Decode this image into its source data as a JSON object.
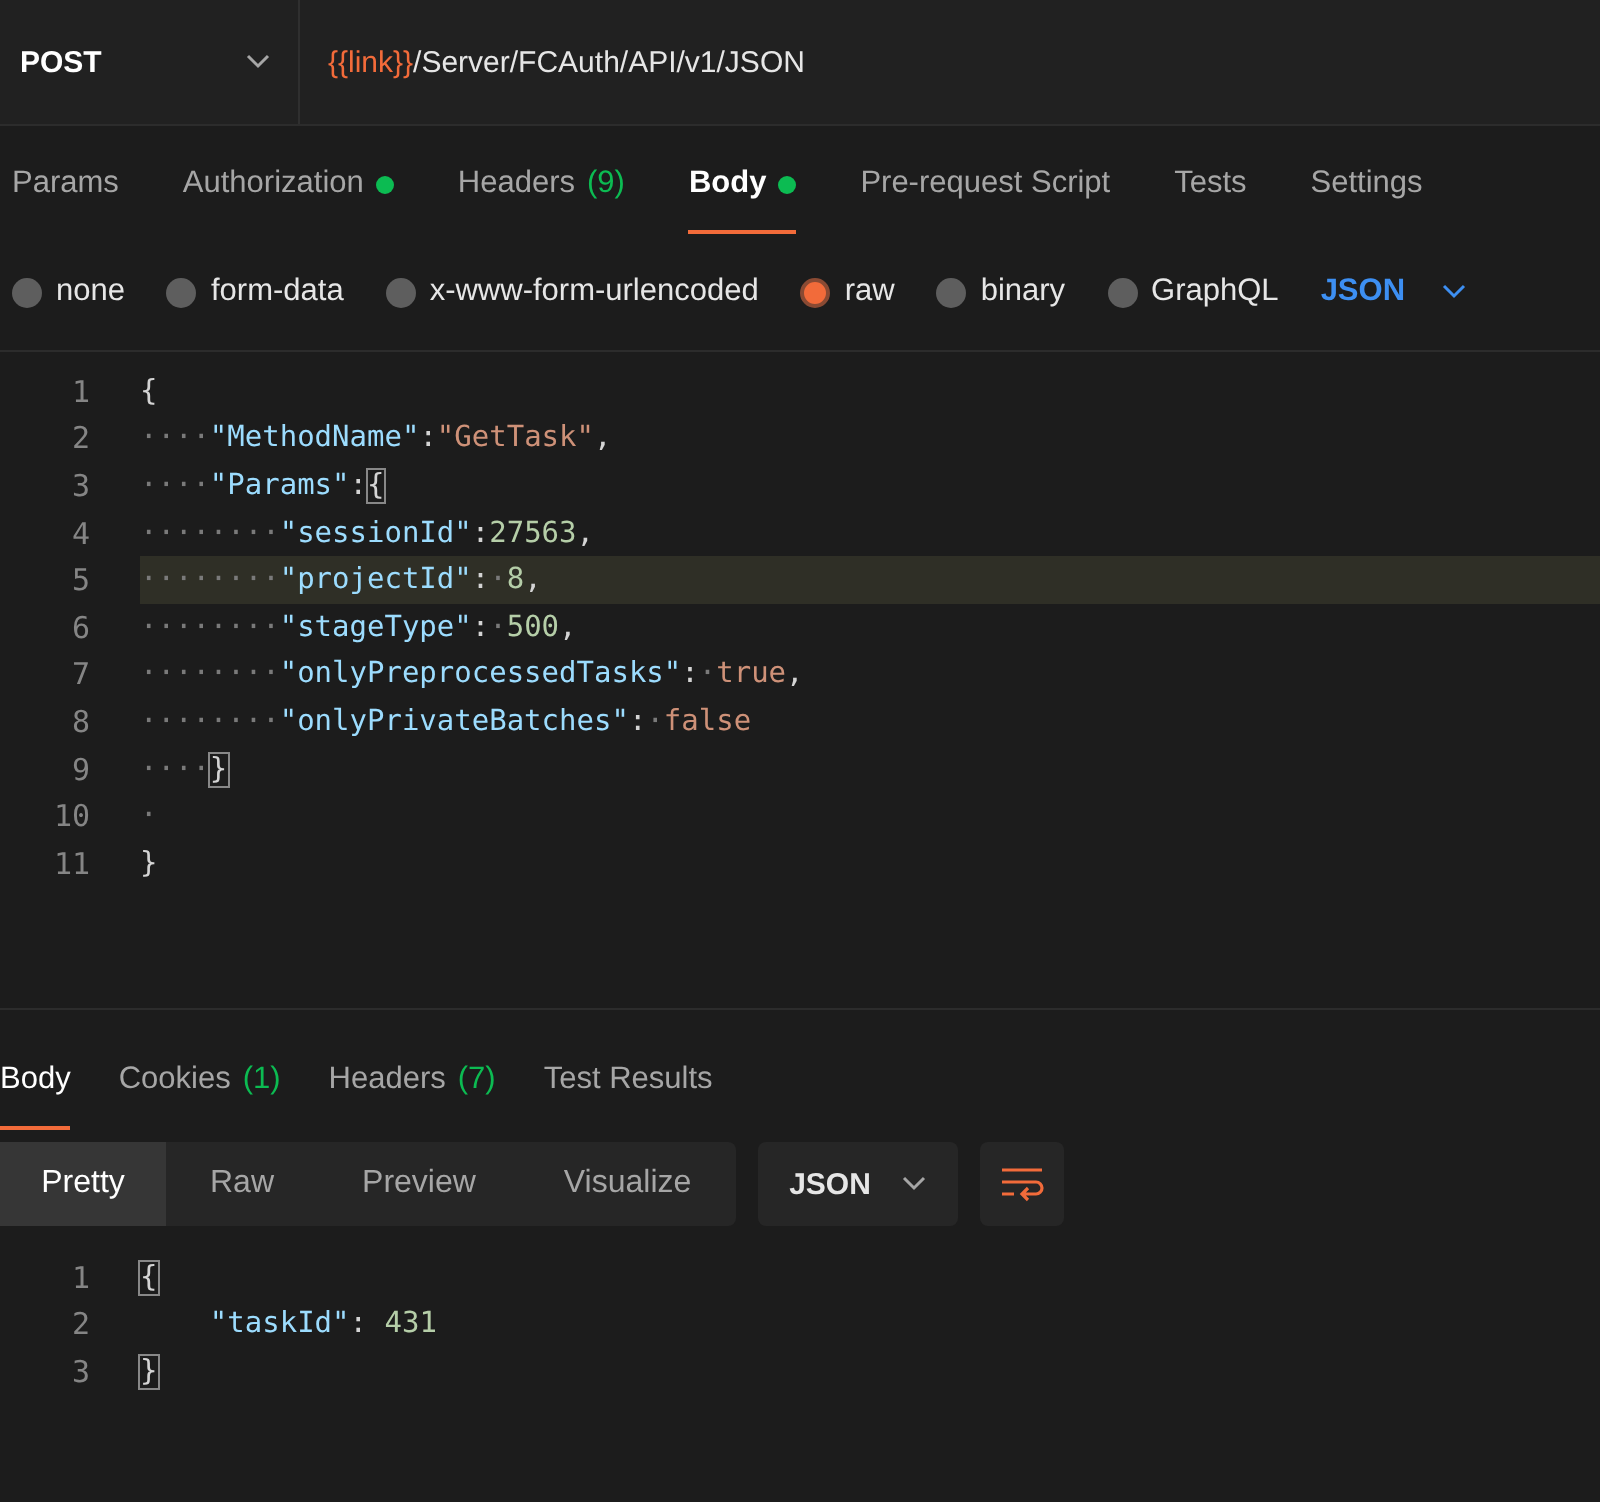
{
  "request": {
    "method": "POST",
    "url_variable": "{{link}}",
    "url_path": "/Server/FCAuth/API/v1/JSON"
  },
  "request_tabs": [
    {
      "label": "Params",
      "selected": false
    },
    {
      "label": "Authorization",
      "selected": false,
      "dot": true
    },
    {
      "label": "Headers",
      "count": "(9)",
      "selected": false
    },
    {
      "label": "Body",
      "selected": true,
      "dot": true
    },
    {
      "label": "Pre-request Script",
      "selected": false
    },
    {
      "label": "Tests",
      "selected": false
    },
    {
      "label": "Settings",
      "selected": false
    }
  ],
  "body_types": [
    {
      "label": "none",
      "selected": false
    },
    {
      "label": "form-data",
      "selected": false
    },
    {
      "label": "x-www-form-urlencoded",
      "selected": false
    },
    {
      "label": "raw",
      "selected": true
    },
    {
      "label": "binary",
      "selected": false
    },
    {
      "label": "GraphQL",
      "selected": false
    }
  ],
  "body_language": "JSON",
  "request_body": [
    {
      "number": "1",
      "highlighted": false,
      "tokens": [
        {
          "kind": "punct",
          "text": "{"
        }
      ]
    },
    {
      "number": "2",
      "highlighted": false,
      "tokens": [
        {
          "kind": "ws",
          "text": "····"
        },
        {
          "kind": "key",
          "text": "\"MethodName\""
        },
        {
          "kind": "punct",
          "text": ":"
        },
        {
          "kind": "string",
          "text": "\"GetTask\""
        },
        {
          "kind": "punct",
          "text": ","
        }
      ]
    },
    {
      "number": "3",
      "highlighted": false,
      "tokens": [
        {
          "kind": "ws",
          "text": "····"
        },
        {
          "kind": "key",
          "text": "\"Params\""
        },
        {
          "kind": "punct",
          "text": ":"
        },
        {
          "kind": "punct",
          "text": "{",
          "matched": true
        }
      ]
    },
    {
      "number": "4",
      "highlighted": false,
      "tokens": [
        {
          "kind": "ws",
          "text": "········"
        },
        {
          "kind": "key",
          "text": "\"sessionId\""
        },
        {
          "kind": "punct",
          "text": ":"
        },
        {
          "kind": "number",
          "text": "27563"
        },
        {
          "kind": "punct",
          "text": ","
        }
      ]
    },
    {
      "number": "5",
      "highlighted": true,
      "tokens": [
        {
          "kind": "ws",
          "text": "········"
        },
        {
          "kind": "key",
          "text": "\"projectId\""
        },
        {
          "kind": "punct",
          "text": ":"
        },
        {
          "kind": "ws",
          "text": "·"
        },
        {
          "kind": "number",
          "text": "8"
        },
        {
          "kind": "punct",
          "text": ","
        }
      ]
    },
    {
      "number": "6",
      "highlighted": false,
      "tokens": [
        {
          "kind": "ws",
          "text": "········"
        },
        {
          "kind": "key",
          "text": "\"stageType\""
        },
        {
          "kind": "punct",
          "text": ":"
        },
        {
          "kind": "ws",
          "text": "·"
        },
        {
          "kind": "number",
          "text": "500"
        },
        {
          "kind": "punct",
          "text": ","
        }
      ]
    },
    {
      "number": "7",
      "highlighted": false,
      "tokens": [
        {
          "kind": "ws",
          "text": "········"
        },
        {
          "kind": "key",
          "text": "\"onlyPreprocessedTasks\""
        },
        {
          "kind": "punct",
          "text": ":"
        },
        {
          "kind": "ws",
          "text": "·"
        },
        {
          "kind": "bool",
          "text": "true"
        },
        {
          "kind": "punct",
          "text": ","
        }
      ]
    },
    {
      "number": "8",
      "highlighted": false,
      "tokens": [
        {
          "kind": "ws",
          "text": "········"
        },
        {
          "kind": "key",
          "text": "\"onlyPrivateBatches\""
        },
        {
          "kind": "punct",
          "text": ":"
        },
        {
          "kind": "ws",
          "text": "·"
        },
        {
          "kind": "bool",
          "text": "false"
        }
      ]
    },
    {
      "number": "9",
      "highlighted": false,
      "tokens": [
        {
          "kind": "ws",
          "text": "····"
        },
        {
          "kind": "punct",
          "text": "}",
          "matched": true
        }
      ]
    },
    {
      "number": "10",
      "highlighted": false,
      "tokens": [
        {
          "kind": "ws",
          "text": "·"
        }
      ]
    },
    {
      "number": "11",
      "highlighted": false,
      "tokens": [
        {
          "kind": "punct",
          "text": "}"
        }
      ]
    }
  ],
  "response_tabs": [
    {
      "label": "Body",
      "selected": true
    },
    {
      "label": "Cookies",
      "count": "(1)",
      "selected": false
    },
    {
      "label": "Headers",
      "count": "(7)",
      "selected": false
    },
    {
      "label": "Test Results",
      "selected": false
    }
  ],
  "view_modes": [
    {
      "label": "Pretty",
      "selected": true
    },
    {
      "label": "Raw",
      "selected": false
    },
    {
      "label": "Preview",
      "selected": false
    },
    {
      "label": "Visualize",
      "selected": false
    }
  ],
  "response_language": "JSON",
  "response_body": [
    {
      "number": "1",
      "highlighted": false,
      "tokens": [
        {
          "kind": "punct",
          "text": "{",
          "matched": true
        }
      ]
    },
    {
      "number": "2",
      "highlighted": false,
      "tokens": [
        {
          "kind": "key",
          "text": "    \"taskId\""
        },
        {
          "kind": "punct",
          "text": ": "
        },
        {
          "kind": "number",
          "text": "431"
        }
      ]
    },
    {
      "number": "3",
      "highlighted": false,
      "tokens": [
        {
          "kind": "punct",
          "text": "}",
          "matched": true
        }
      ]
    }
  ]
}
